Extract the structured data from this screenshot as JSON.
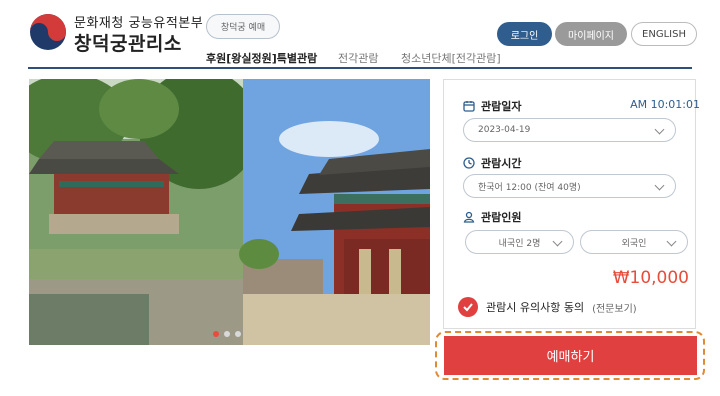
{
  "header": {
    "org_name": "문화재청 궁능유적본부",
    "site_name": "창덕궁관리소",
    "reserve_pill": "창덕궁 예매",
    "nav": [
      "후원[왕실정원]특별관람",
      "전각관람",
      "청소년단체[전각관람]"
    ],
    "login": "로그인",
    "mypage": "마이페이지",
    "english": "ENGLISH"
  },
  "booking": {
    "date_label": "관람일자",
    "current_time": "AM 10:01:01",
    "date_value": "2023-04-19",
    "time_label": "관람시간",
    "time_value": "한국어 12:00 (잔여 40명)",
    "people_label": "관람인원",
    "domestic_value": "내국인 2명",
    "foreign_value": "외국인",
    "price": "₩10,000",
    "agree_text": "관람시 유의사항 동의",
    "agree_more": "(전문보기)",
    "submit": "예매하기"
  },
  "colors": {
    "brand_blue": "#2e5d8e",
    "accent_red": "#e04040",
    "highlight_orange": "#e08a34"
  },
  "slider": {
    "dots": 3,
    "active_index": 0
  }
}
